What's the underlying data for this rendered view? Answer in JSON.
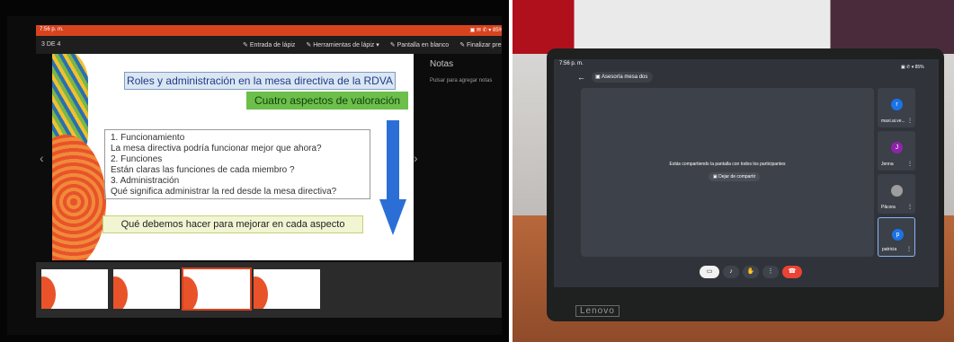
{
  "left": {
    "statusbar": {
      "time": "7:56 p. m.",
      "icons": "▣ ✉ ✆ ▾ 85%"
    },
    "toolbar": {
      "slide_counter": "3 DE 4",
      "tools": [
        "Entrada de lápiz",
        "Herramientas de lápiz ▾",
        "Pantalla en blanco",
        "Finalizar presentación"
      ]
    },
    "slide": {
      "title": "Roles y administración  en la mesa directiva de la RDVA",
      "subtitle": "Cuatro  aspectos de valoración",
      "lines": [
        "1. Funcionamiento",
        "La mesa directiva podría funcionar mejor que ahora?",
        "2. Funciones",
        "Están claras las funciones de cada miembro ?",
        "3. Administración",
        "Qué significa administrar la red desde la mesa directiva?"
      ],
      "bottom": "Qué debemos hacer para mejorar en cada aspecto"
    },
    "notes": {
      "heading": "Notas",
      "placeholder": "Pulsar para agregar notas"
    },
    "thumbnails": [
      {
        "num": "1"
      },
      {
        "num": "2"
      },
      {
        "num": "3",
        "selected": true
      },
      {
        "num": "4"
      }
    ]
  },
  "right": {
    "status": {
      "time": "7:56 p. m.",
      "icons": "▣ ✆ ▾ 85%"
    },
    "meeting_title": "Asesoría mesa dos",
    "share_message": "Estás compartiendo la pantalla con todos los participantes",
    "stop_sharing": "Dejar de compartir",
    "participants": [
      {
        "initial": "r",
        "name": "maxi.ai.ve...",
        "color": "#1a73e8"
      },
      {
        "initial": "J",
        "name": "Jenna",
        "color": "#8e24aa"
      },
      {
        "initial": "",
        "name": "Pâcora",
        "color": "#9e9e9e"
      },
      {
        "initial": "p",
        "name": "patricia",
        "color": "#1a73e8"
      }
    ],
    "brand": "Lenovo"
  }
}
